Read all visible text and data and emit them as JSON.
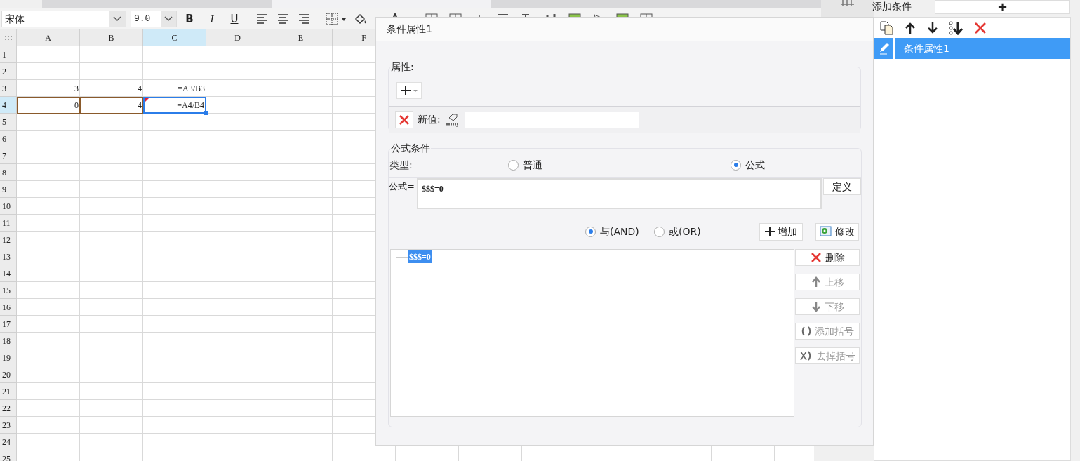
{
  "toolbar": {
    "font": "宋体",
    "size": "9.0",
    "styles": [
      "B",
      "I",
      "U"
    ]
  },
  "sheet": {
    "columns": [
      {
        "label": "A",
        "selected": false
      },
      {
        "label": "B",
        "selected": false
      },
      {
        "label": "C",
        "selected": true
      },
      {
        "label": "D",
        "selected": false
      },
      {
        "label": "E",
        "selected": false
      },
      {
        "label": "F",
        "selected": false
      }
    ],
    "rows": [
      {
        "label": "1",
        "selected": false
      },
      {
        "label": "2",
        "selected": false
      },
      {
        "label": "3",
        "selected": false,
        "cells": [
          {
            "text": "3",
            "referenced": false,
            "selected": false
          },
          {
            "text": "4",
            "referenced": false,
            "selected": false
          },
          {
            "text": "=A3/B3",
            "referenced": false,
            "selected": false
          }
        ]
      },
      {
        "label": "4",
        "selected": true,
        "cells": [
          {
            "text": "0",
            "referenced": true,
            "selected": false
          },
          {
            "text": "4",
            "referenced": true,
            "selected": false
          },
          {
            "text": "=A4/B4",
            "selected": true,
            "flagged": true
          }
        ]
      },
      {
        "label": "5",
        "selected": false
      },
      {
        "label": "6",
        "selected": false
      },
      {
        "label": "7",
        "selected": false
      },
      {
        "label": "8",
        "selected": false
      },
      {
        "label": "9",
        "selected": false
      },
      {
        "label": "10",
        "selected": false
      },
      {
        "label": "11",
        "selected": false
      },
      {
        "label": "12",
        "selected": false
      },
      {
        "label": "13",
        "selected": false
      },
      {
        "label": "14",
        "selected": false
      },
      {
        "label": "15",
        "selected": false
      },
      {
        "label": "16",
        "selected": false
      },
      {
        "label": "17",
        "selected": false
      },
      {
        "label": "18",
        "selected": false
      },
      {
        "label": "19",
        "selected": false
      },
      {
        "label": "20",
        "selected": false
      },
      {
        "label": "21",
        "selected": false
      },
      {
        "label": "22",
        "selected": false
      },
      {
        "label": "23",
        "selected": false
      },
      {
        "label": "24",
        "selected": false
      },
      {
        "label": "25",
        "selected": false
      }
    ]
  },
  "dialog": {
    "title": "条件属性1",
    "property": {
      "title": "属性:",
      "new_value_label": "新值:"
    },
    "formula_condition": {
      "title": "公式条件",
      "type_label": "类型:",
      "types": [
        {
          "label": "普通",
          "selected": false
        },
        {
          "label": "公式",
          "selected": true
        }
      ],
      "formula_label": "公式=",
      "formula": "$$$=0",
      "define_button": "定义",
      "logic": [
        {
          "label": "与(AND)",
          "selected": true
        },
        {
          "label": "或(OR)",
          "selected": false
        }
      ],
      "add_button": "增加",
      "edit_button": "修改",
      "conditions": [
        {
          "text": "$$$=0",
          "selected": true
        }
      ],
      "side_buttons": [
        {
          "label": "删除",
          "disabled": false
        },
        {
          "label": "上移",
          "disabled": true
        },
        {
          "label": "下移",
          "disabled": true
        },
        {
          "label": "添加括号",
          "disabled": true
        },
        {
          "label": "去掉括号",
          "disabled": true
        }
      ]
    }
  },
  "conditions_panel": {
    "add_label": "添加条件",
    "add_button": "+",
    "items": [
      {
        "label": "条件属性1",
        "selected": true
      }
    ]
  }
}
